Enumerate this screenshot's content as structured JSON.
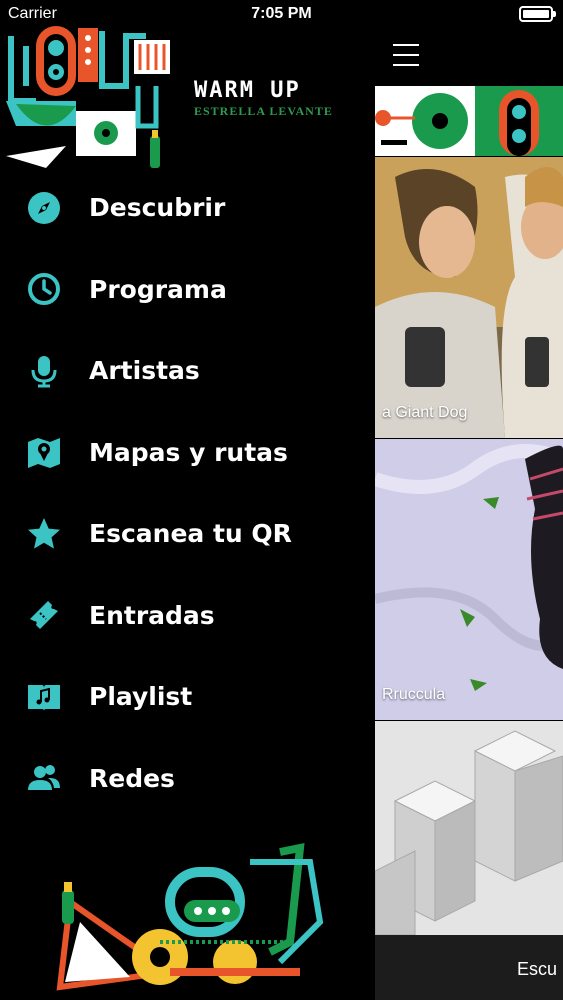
{
  "status_bar": {
    "carrier": "Carrier",
    "time": "7:05 PM"
  },
  "brand": {
    "wordmark": "WARM UP",
    "subtitle": "ESTRELLA LEVANTE",
    "logo_icon": "festival-logo-illustration"
  },
  "menu": {
    "items": [
      {
        "label": "Descubrir",
        "icon": "compass-icon"
      },
      {
        "label": "Programa",
        "icon": "clock-icon"
      },
      {
        "label": "Artistas",
        "icon": "microphone-icon"
      },
      {
        "label": "Mapas y rutas",
        "icon": "map-icon"
      },
      {
        "label": "Escanea tu QR",
        "icon": "star-icon"
      },
      {
        "label": "Entradas",
        "icon": "ticket-icon"
      },
      {
        "label": "Playlist",
        "icon": "music-book-icon"
      },
      {
        "label": "Redes",
        "icon": "people-icon"
      }
    ],
    "icon_color": "#3cc3c3"
  },
  "content": {
    "cards": [
      {
        "label": "a Giant Dog"
      },
      {
        "label": "Rruccula"
      },
      {
        "label": ""
      }
    ],
    "bottom_bar": {
      "label": "Escu"
    }
  },
  "colors": {
    "teal": "#3cc3c3",
    "orange": "#e8552a",
    "green": "#1a9a4c",
    "yellow": "#f4c430",
    "background": "#000000"
  }
}
